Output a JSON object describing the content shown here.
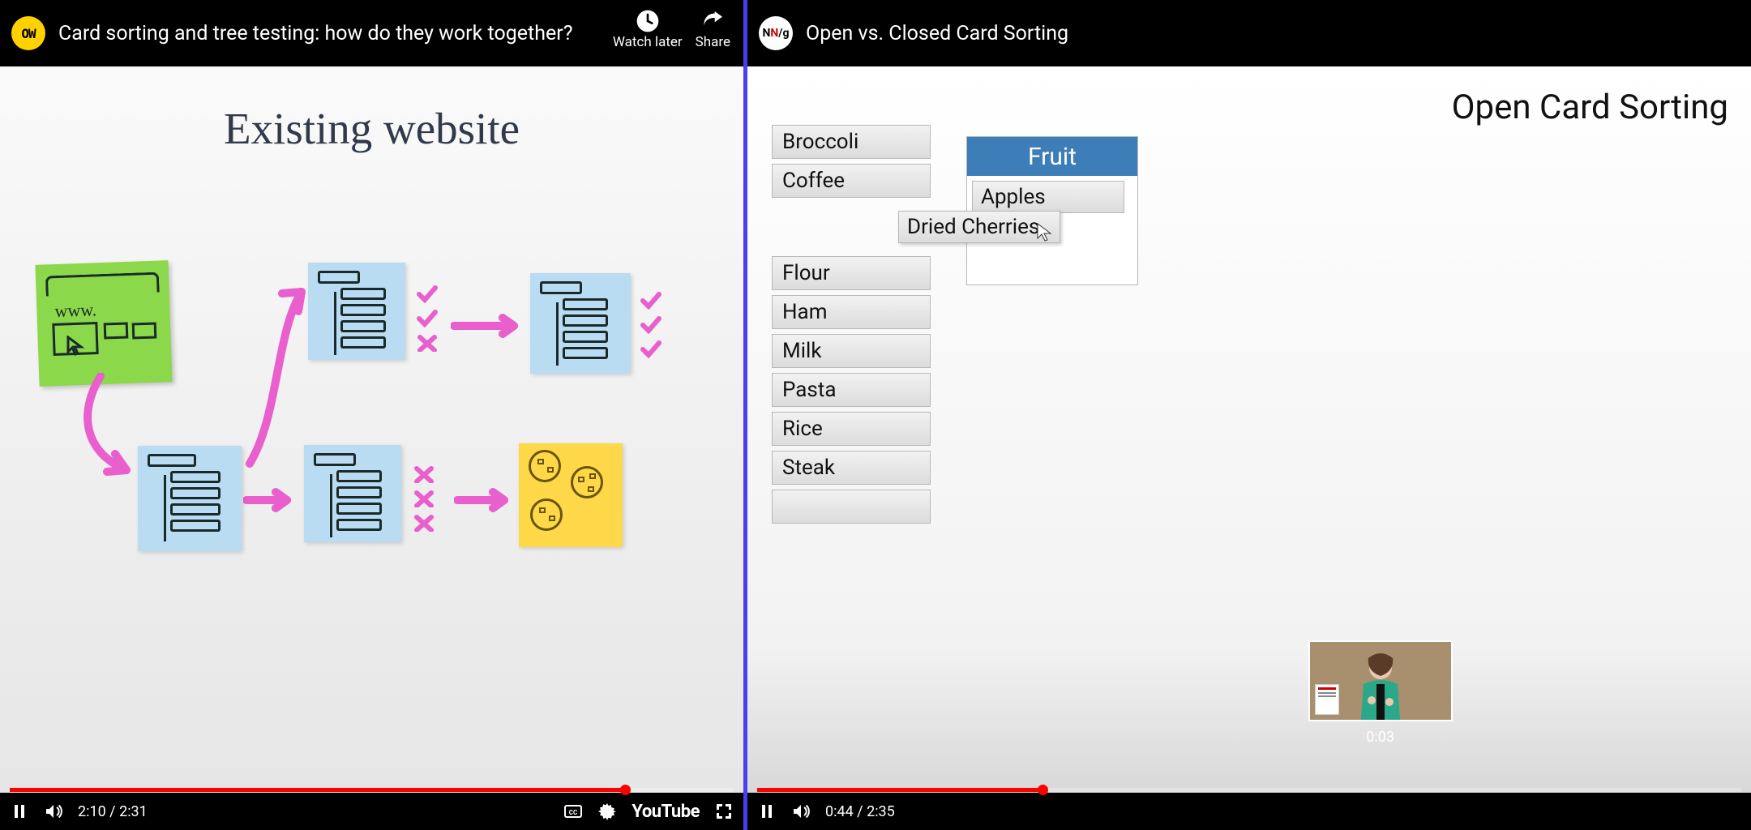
{
  "left": {
    "channel_badge": "OW",
    "title": "Card sorting and tree testing: how do they work together?",
    "actions": {
      "watch_later": "Watch later",
      "share": "Share"
    },
    "slide_title": "Existing website",
    "www_label": "www.",
    "time_current": "2:10",
    "time_total": "2:31",
    "progress_pct": 85,
    "youtube_label": "YouTube"
  },
  "right": {
    "channel_badge_html": {
      "n1": "N",
      "n2": "N",
      "slash": "/g"
    },
    "title": "Open vs. Closed Card Sorting",
    "slide_title": "Open Card Sorting",
    "cards": [
      "Broccoli",
      "Coffee",
      "Flour",
      "Ham",
      "Milk",
      "Pasta",
      "Rice",
      "Steak"
    ],
    "fruit_header": "Fruit",
    "fruit_items": [
      "Apples"
    ],
    "drag_card": "Dried Cherries",
    "seek_preview_time": "0:03",
    "time_current": "0:44",
    "time_total": "2:35",
    "progress_pct": 29
  }
}
